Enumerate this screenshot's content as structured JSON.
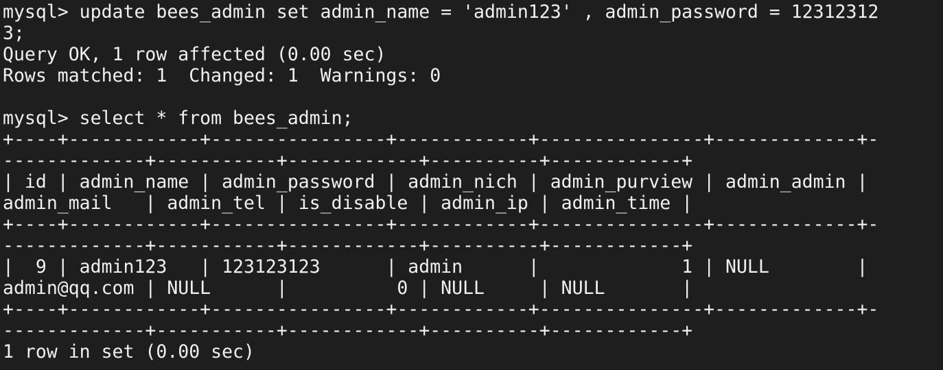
{
  "terminal": {
    "lines": [
      "mysql> update bees_admin set admin_name = 'admin123' , admin_password = 12312312",
      "3;",
      "Query OK, 1 row affected (0.00 sec)",
      "Rows matched: 1  Changed: 1  Warnings: 0",
      "",
      "mysql> select * from bees_admin;",
      "+----+------------+----------------+------------+---------------+-------------+-",
      "-------------+-----------+------------+----------+------------+",
      "| id | admin_name | admin_password | admin_nich | admin_purview | admin_admin |",
      "admin_mail   | admin_tel | is_disable | admin_ip | admin_time |",
      "+----+------------+----------------+------------+---------------+-------------+-",
      "-------------+-----------+------------+----------+------------+",
      "|  9 | admin123   | 123123123      | admin      |             1 | NULL        |",
      "admin@qq.com | NULL      |          0 | NULL     | NULL       |",
      "+----+------------+----------------+------------+---------------+-------------+-",
      "-------------+-----------+------------+----------+------------+",
      "1 row in set (0.00 sec)"
    ]
  }
}
